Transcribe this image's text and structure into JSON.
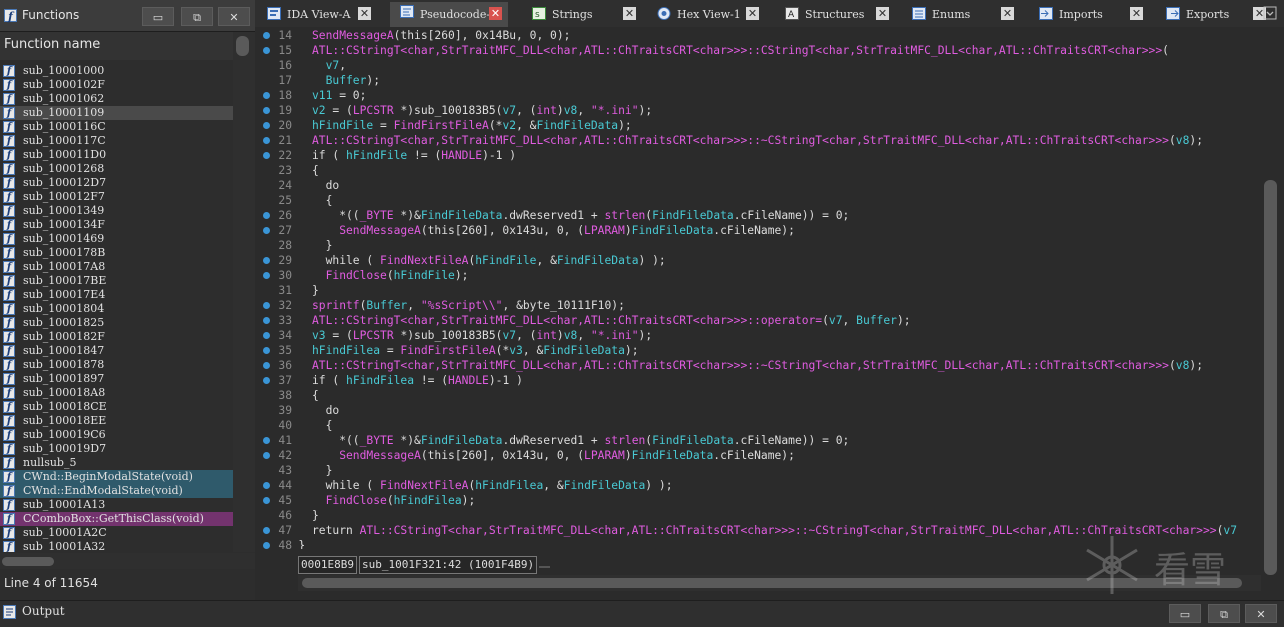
{
  "functions_panel": {
    "title": "Functions",
    "column_header": "Function name",
    "status": "Line 4 of 11654",
    "items": [
      {
        "label": "sub_10001000",
        "style": ""
      },
      {
        "label": "sub_1000102F",
        "style": ""
      },
      {
        "label": "sub_10001062",
        "style": ""
      },
      {
        "label": "sub_10001109",
        "style": "sel"
      },
      {
        "label": "sub_1000116C",
        "style": ""
      },
      {
        "label": "sub_1000117C",
        "style": ""
      },
      {
        "label": "sub_100011D0",
        "style": ""
      },
      {
        "label": "sub_10001268",
        "style": ""
      },
      {
        "label": "sub_100012D7",
        "style": ""
      },
      {
        "label": "sub_100012F7",
        "style": ""
      },
      {
        "label": "sub_10001349",
        "style": ""
      },
      {
        "label": "sub_1000134F",
        "style": ""
      },
      {
        "label": "sub_10001469",
        "style": ""
      },
      {
        "label": "sub_1000178B",
        "style": ""
      },
      {
        "label": "sub_100017A8",
        "style": ""
      },
      {
        "label": "sub_100017BE",
        "style": ""
      },
      {
        "label": "sub_100017E4",
        "style": ""
      },
      {
        "label": "sub_10001804",
        "style": ""
      },
      {
        "label": "sub_10001825",
        "style": ""
      },
      {
        "label": "sub_1000182F",
        "style": ""
      },
      {
        "label": "sub_10001847",
        "style": ""
      },
      {
        "label": "sub_10001878",
        "style": ""
      },
      {
        "label": "sub_10001897",
        "style": ""
      },
      {
        "label": "sub_100018A8",
        "style": ""
      },
      {
        "label": "sub_100018CE",
        "style": ""
      },
      {
        "label": "sub_100018EE",
        "style": ""
      },
      {
        "label": "sub_100019C6",
        "style": ""
      },
      {
        "label": "sub_100019D7",
        "style": ""
      },
      {
        "label": "nullsub_5",
        "style": ""
      },
      {
        "label": "CWnd::BeginModalState(void)",
        "style": "lib"
      },
      {
        "label": "CWnd::EndModalState(void)",
        "style": "lib"
      },
      {
        "label": "sub_10001A13",
        "style": ""
      },
      {
        "label": "CComboBox::GetThisClass(void)",
        "style": "thunk"
      },
      {
        "label": "sub_10001A2C",
        "style": ""
      },
      {
        "label": "sub_10001A32",
        "style": ""
      }
    ]
  },
  "tabs": [
    {
      "label": "IDA View-A",
      "icon": "ida-view-icon",
      "active": false
    },
    {
      "label": "Pseudocode-A",
      "icon": "pseudocode-icon",
      "active": true
    },
    {
      "label": "Strings",
      "icon": "strings-icon",
      "active": false
    },
    {
      "label": "Hex View-1",
      "icon": "hex-view-icon",
      "active": false
    },
    {
      "label": "Structures",
      "icon": "structures-icon",
      "active": false
    },
    {
      "label": "Enums",
      "icon": "enums-icon",
      "active": false
    },
    {
      "label": "Imports",
      "icon": "imports-icon",
      "active": false
    },
    {
      "label": "Exports",
      "icon": "exports-icon",
      "active": false
    }
  ],
  "code": {
    "lines": [
      {
        "n": "14",
        "dot": true,
        "indent": 0,
        "parts": [
          [
            "fn",
            "SendMessageA"
          ],
          [
            "t",
            "(this[260], 0x14Bu, 0, 0);"
          ]
        ]
      },
      {
        "n": "15",
        "dot": true,
        "indent": 0,
        "parts": [
          [
            "fn",
            "ATL::CStringT<char,StrTraitMFC_DLL<char,ATL::ChTraitsCRT<char>>>::CStringT<char,StrTraitMFC_DLL<char,ATL::ChTraitsCRT<char>>>"
          ],
          [
            "t",
            "("
          ]
        ]
      },
      {
        "n": "16",
        "dot": false,
        "indent": 2,
        "parts": [
          [
            "var",
            "v7"
          ],
          [
            "t",
            ","
          ]
        ]
      },
      {
        "n": "17",
        "dot": false,
        "indent": 2,
        "parts": [
          [
            "var",
            "Buffer"
          ],
          [
            "t",
            ");"
          ]
        ]
      },
      {
        "n": "18",
        "dot": true,
        "indent": 0,
        "parts": [
          [
            "var",
            "v11"
          ],
          [
            "t",
            " = 0;"
          ]
        ]
      },
      {
        "n": "19",
        "dot": true,
        "indent": 0,
        "parts": [
          [
            "var",
            "v2"
          ],
          [
            "t",
            " = ("
          ],
          [
            "fn",
            "LPCSTR"
          ],
          [
            "t",
            " *)sub_100183B5("
          ],
          [
            "var",
            "v7"
          ],
          [
            "t",
            ", ("
          ],
          [
            "fn",
            "int"
          ],
          [
            "t",
            ")"
          ],
          [
            "var",
            "v8"
          ],
          [
            "t",
            ", "
          ],
          [
            "str",
            "\"*.ini\""
          ],
          [
            "t",
            ");"
          ]
        ]
      },
      {
        "n": "20",
        "dot": true,
        "indent": 0,
        "parts": [
          [
            "var",
            "hFindFile"
          ],
          [
            "t",
            " = "
          ],
          [
            "fn",
            "FindFirstFileA"
          ],
          [
            "t",
            "(*"
          ],
          [
            "var",
            "v2"
          ],
          [
            "t",
            ", &"
          ],
          [
            "var",
            "FindFileData"
          ],
          [
            "t",
            ");"
          ]
        ]
      },
      {
        "n": "21",
        "dot": true,
        "indent": 0,
        "parts": [
          [
            "fn",
            "ATL::CStringT<char,StrTraitMFC_DLL<char,ATL::ChTraitsCRT<char>>>::~CStringT<char,StrTraitMFC_DLL<char,ATL::ChTraitsCRT<char>>>"
          ],
          [
            "t",
            "("
          ],
          [
            "var",
            "v8"
          ],
          [
            "t",
            ");"
          ]
        ]
      },
      {
        "n": "22",
        "dot": true,
        "indent": 0,
        "parts": [
          [
            "t",
            "if ( "
          ],
          [
            "var",
            "hFindFile"
          ],
          [
            "t",
            " != ("
          ],
          [
            "fn",
            "HANDLE"
          ],
          [
            "t",
            ")-1 )"
          ]
        ]
      },
      {
        "n": "23",
        "dot": false,
        "indent": 0,
        "parts": [
          [
            "t",
            "{"
          ]
        ]
      },
      {
        "n": "24",
        "dot": false,
        "indent": 2,
        "parts": [
          [
            "t",
            "do"
          ]
        ]
      },
      {
        "n": "25",
        "dot": false,
        "indent": 2,
        "parts": [
          [
            "t",
            "{"
          ]
        ]
      },
      {
        "n": "26",
        "dot": true,
        "indent": 4,
        "parts": [
          [
            "t",
            "*(("
          ],
          [
            "fn",
            "_BYTE"
          ],
          [
            "t",
            " *)&"
          ],
          [
            "var",
            "FindFileData"
          ],
          [
            "t",
            ".dwReserved1 + "
          ],
          [
            "fn",
            "strlen"
          ],
          [
            "t",
            "("
          ],
          [
            "var",
            "FindFileData"
          ],
          [
            "t",
            ".cFileName)) = 0;"
          ]
        ]
      },
      {
        "n": "27",
        "dot": true,
        "indent": 4,
        "parts": [
          [
            "fn",
            "SendMessageA"
          ],
          [
            "t",
            "(this[260], 0x143u, 0, ("
          ],
          [
            "fn",
            "LPARAM"
          ],
          [
            "t",
            ")"
          ],
          [
            "var",
            "FindFileData"
          ],
          [
            "t",
            ".cFileName);"
          ]
        ]
      },
      {
        "n": "28",
        "dot": false,
        "indent": 2,
        "parts": [
          [
            "t",
            "}"
          ]
        ]
      },
      {
        "n": "29",
        "dot": true,
        "indent": 2,
        "parts": [
          [
            "t",
            "while ( "
          ],
          [
            "fn",
            "FindNextFileA"
          ],
          [
            "t",
            "("
          ],
          [
            "var",
            "hFindFile"
          ],
          [
            "t",
            ", &"
          ],
          [
            "var",
            "FindFileData"
          ],
          [
            "t",
            ") );"
          ]
        ]
      },
      {
        "n": "30",
        "dot": true,
        "indent": 2,
        "parts": [
          [
            "fn",
            "FindClose"
          ],
          [
            "t",
            "("
          ],
          [
            "var",
            "hFindFile"
          ],
          [
            "t",
            ");"
          ]
        ]
      },
      {
        "n": "31",
        "dot": false,
        "indent": 0,
        "parts": [
          [
            "t",
            "}"
          ]
        ]
      },
      {
        "n": "32",
        "dot": true,
        "indent": 0,
        "parts": [
          [
            "fn",
            "sprintf"
          ],
          [
            "t",
            "("
          ],
          [
            "var",
            "Buffer"
          ],
          [
            "t",
            ", "
          ],
          [
            "str",
            "\"%sScript\\\\\""
          ],
          [
            "t",
            ", &byte_10111F10);"
          ]
        ]
      },
      {
        "n": "33",
        "dot": true,
        "indent": 0,
        "parts": [
          [
            "fn",
            "ATL::CStringT<char,StrTraitMFC_DLL<char,ATL::ChTraitsCRT<char>>>::operator="
          ],
          [
            "t",
            "("
          ],
          [
            "var",
            "v7"
          ],
          [
            "t",
            ", "
          ],
          [
            "var",
            "Buffer"
          ],
          [
            "t",
            ");"
          ]
        ]
      },
      {
        "n": "34",
        "dot": true,
        "indent": 0,
        "parts": [
          [
            "var",
            "v3"
          ],
          [
            "t",
            " = ("
          ],
          [
            "fn",
            "LPCSTR"
          ],
          [
            "t",
            " *)sub_100183B5("
          ],
          [
            "var",
            "v7"
          ],
          [
            "t",
            ", ("
          ],
          [
            "fn",
            "int"
          ],
          [
            "t",
            ")"
          ],
          [
            "var",
            "v8"
          ],
          [
            "t",
            ", "
          ],
          [
            "str",
            "\"*.ini\""
          ],
          [
            "t",
            ");"
          ]
        ]
      },
      {
        "n": "35",
        "dot": true,
        "indent": 0,
        "parts": [
          [
            "var",
            "hFindFilea"
          ],
          [
            "t",
            " = "
          ],
          [
            "fn",
            "FindFirstFileA"
          ],
          [
            "t",
            "(*"
          ],
          [
            "var",
            "v3"
          ],
          [
            "t",
            ", &"
          ],
          [
            "var",
            "FindFileData"
          ],
          [
            "t",
            ");"
          ]
        ]
      },
      {
        "n": "36",
        "dot": true,
        "indent": 0,
        "parts": [
          [
            "fn",
            "ATL::CStringT<char,StrTraitMFC_DLL<char,ATL::ChTraitsCRT<char>>>::~CStringT<char,StrTraitMFC_DLL<char,ATL::ChTraitsCRT<char>>>"
          ],
          [
            "t",
            "("
          ],
          [
            "var",
            "v8"
          ],
          [
            "t",
            ");"
          ]
        ]
      },
      {
        "n": "37",
        "dot": true,
        "indent": 0,
        "parts": [
          [
            "t",
            "if ( "
          ],
          [
            "var",
            "hFindFilea"
          ],
          [
            "t",
            " != ("
          ],
          [
            "fn",
            "HANDLE"
          ],
          [
            "t",
            ")-1 )"
          ]
        ]
      },
      {
        "n": "38",
        "dot": false,
        "indent": 0,
        "parts": [
          [
            "t",
            "{"
          ]
        ]
      },
      {
        "n": "39",
        "dot": false,
        "indent": 2,
        "parts": [
          [
            "t",
            "do"
          ]
        ]
      },
      {
        "n": "40",
        "dot": false,
        "indent": 2,
        "parts": [
          [
            "t",
            "{"
          ]
        ]
      },
      {
        "n": "41",
        "dot": true,
        "indent": 4,
        "parts": [
          [
            "t",
            "*(("
          ],
          [
            "fn",
            "_BYTE"
          ],
          [
            "t",
            " *)&"
          ],
          [
            "var",
            "FindFileData"
          ],
          [
            "t",
            ".dwReserved1 + "
          ],
          [
            "fn",
            "strlen"
          ],
          [
            "t",
            "("
          ],
          [
            "var",
            "FindFileData"
          ],
          [
            "t",
            ".cFileName)) = 0;"
          ]
        ]
      },
      {
        "n": "42",
        "dot": true,
        "indent": 4,
        "hl": true,
        "parts": [
          [
            "fn",
            "SendMessageA"
          ],
          [
            "t",
            "(this[260], 0x143u, 0, ("
          ],
          [
            "fn",
            "LPARAM"
          ],
          [
            "t",
            ")"
          ],
          [
            "var",
            "FindFileData"
          ],
          [
            "t",
            ".cFileName);"
          ]
        ]
      },
      {
        "n": "43",
        "dot": false,
        "indent": 2,
        "parts": [
          [
            "t",
            "}"
          ]
        ]
      },
      {
        "n": "44",
        "dot": true,
        "indent": 2,
        "parts": [
          [
            "t",
            "while ( "
          ],
          [
            "fn",
            "FindNextFileA"
          ],
          [
            "t",
            "("
          ],
          [
            "var",
            "hFindFilea"
          ],
          [
            "t",
            ", &"
          ],
          [
            "var",
            "FindFileData"
          ],
          [
            "t",
            ") );"
          ]
        ]
      },
      {
        "n": "45",
        "dot": true,
        "indent": 2,
        "parts": [
          [
            "fn",
            "FindClose"
          ],
          [
            "t",
            "("
          ],
          [
            "var",
            "hFindFilea"
          ],
          [
            "t",
            ");"
          ]
        ]
      },
      {
        "n": "46",
        "dot": false,
        "indent": 0,
        "parts": [
          [
            "t",
            "}"
          ]
        ]
      },
      {
        "n": "47",
        "dot": true,
        "indent": 0,
        "parts": [
          [
            "t",
            "return "
          ],
          [
            "fn",
            "ATL::CStringT<char,StrTraitMFC_DLL<char,ATL::ChTraitsCRT<char>>>::~CStringT<char,StrTraitMFC_DLL<char,ATL::ChTraitsCRT<char>>>"
          ],
          [
            "t",
            "("
          ],
          [
            "var",
            "v7"
          ]
        ]
      },
      {
        "n": "48",
        "dot": true,
        "indent": -2,
        "parts": [
          [
            "t",
            "}"
          ]
        ]
      }
    ]
  },
  "address_bar": {
    "offset": "0001E8B9",
    "location": "sub_1001F321:42 (1001F4B9)"
  },
  "watermark_text": "看雪",
  "output_panel": {
    "title": "Output"
  },
  "window_buttons": {
    "restore": "▭",
    "float": "⧉",
    "close": "✕"
  },
  "colors": {
    "function_name": "#e05ce0",
    "variable": "#49c9d3",
    "breakpoint_dot": "#3a95d6",
    "active_tab_close": "#d9534f",
    "library_function_bg": "#2f5a6b",
    "thunk_function_bg": "#73336e"
  }
}
